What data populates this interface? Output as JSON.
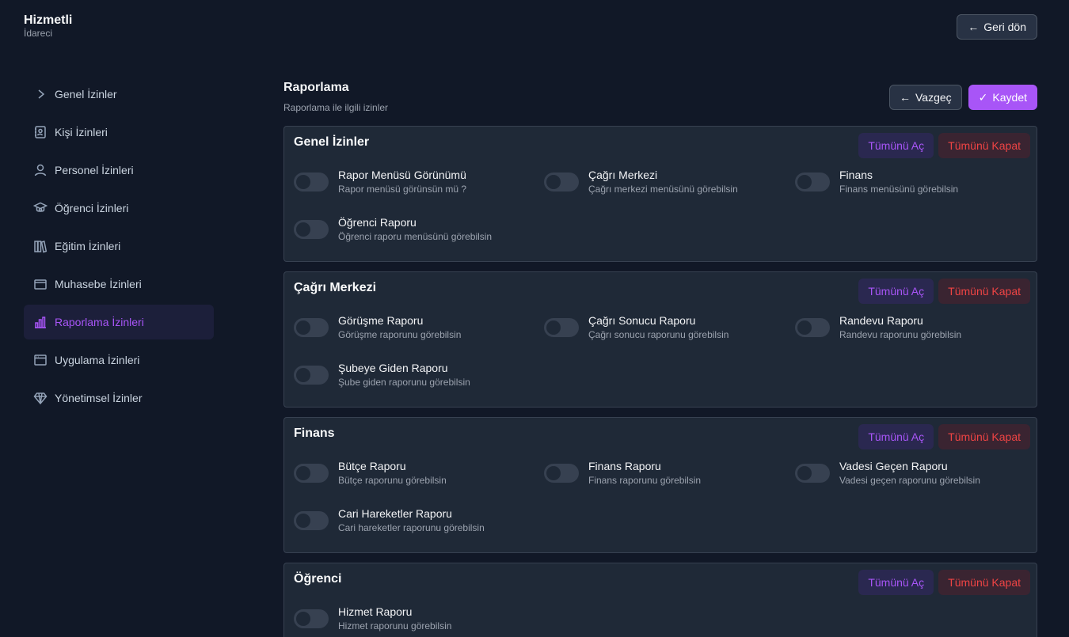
{
  "brand": {
    "title": "Hizmetli",
    "subtitle": "İdareci"
  },
  "header": {
    "back_label": "Geri dön"
  },
  "sidebar": {
    "items": [
      {
        "label": "Genel İzinler",
        "icon": "chevron-right-icon",
        "active": false
      },
      {
        "label": "Kişi İzinleri",
        "icon": "contact-book-icon",
        "active": false
      },
      {
        "label": "Personel İzinleri",
        "icon": "user-icon",
        "active": false
      },
      {
        "label": "Öğrenci İzinleri",
        "icon": "graduate-icon",
        "active": false
      },
      {
        "label": "Eğitim İzinleri",
        "icon": "books-icon",
        "active": false
      },
      {
        "label": "Muhasebe İzinleri",
        "icon": "wallet-icon",
        "active": false
      },
      {
        "label": "Raporlama İzinleri",
        "icon": "bar-chart-icon",
        "active": true
      },
      {
        "label": "Uygulama İzinleri",
        "icon": "app-window-icon",
        "active": false
      },
      {
        "label": "Yönetimsel İzinler",
        "icon": "diamond-icon",
        "active": false
      }
    ]
  },
  "main": {
    "title": "Raporlama",
    "subtitle": "Raporlama ile ilgili izinler",
    "cancel_label": "Vazgeç",
    "save_label": "Kaydet",
    "open_all_label": "Tümünü Aç",
    "close_all_label": "Tümünü Kapat",
    "sections": [
      {
        "title": "Genel İzinler",
        "permissions": [
          {
            "title": "Rapor Menüsü Görünümü",
            "desc": "Rapor menüsü görünsün mü ?",
            "enabled": false
          },
          {
            "title": "Çağrı Merkezi",
            "desc": "Çağrı merkezi menüsünü görebilsin",
            "enabled": false
          },
          {
            "title": "Finans",
            "desc": "Finans menüsünü görebilsin",
            "enabled": false
          },
          {
            "title": "Öğrenci Raporu",
            "desc": "Öğrenci raporu menüsünü görebilsin",
            "enabled": false
          }
        ]
      },
      {
        "title": "Çağrı Merkezi",
        "permissions": [
          {
            "title": "Görüşme Raporu",
            "desc": "Görüşme raporunu görebilsin",
            "enabled": false
          },
          {
            "title": "Çağrı Sonucu Raporu",
            "desc": "Çağrı sonucu raporunu görebilsin",
            "enabled": false
          },
          {
            "title": "Randevu Raporu",
            "desc": "Randevu raporunu görebilsin",
            "enabled": false
          },
          {
            "title": "Şubeye Giden Raporu",
            "desc": "Şube giden raporunu görebilsin",
            "enabled": false
          }
        ]
      },
      {
        "title": "Finans",
        "permissions": [
          {
            "title": "Bütçe Raporu",
            "desc": "Bütçe raporunu görebilsin",
            "enabled": false
          },
          {
            "title": "Finans Raporu",
            "desc": "Finans raporunu görebilsin",
            "enabled": false
          },
          {
            "title": "Vadesi Geçen Raporu",
            "desc": "Vadesi geçen raporunu görebilsin",
            "enabled": false
          },
          {
            "title": "Cari Hareketler Raporu",
            "desc": "Cari hareketler raporunu görebilsin",
            "enabled": false
          }
        ]
      },
      {
        "title": "Öğrenci",
        "permissions": [
          {
            "title": "Hizmet Raporu",
            "desc": "Hizmet raporunu görebilsin",
            "enabled": false
          }
        ]
      }
    ]
  }
}
